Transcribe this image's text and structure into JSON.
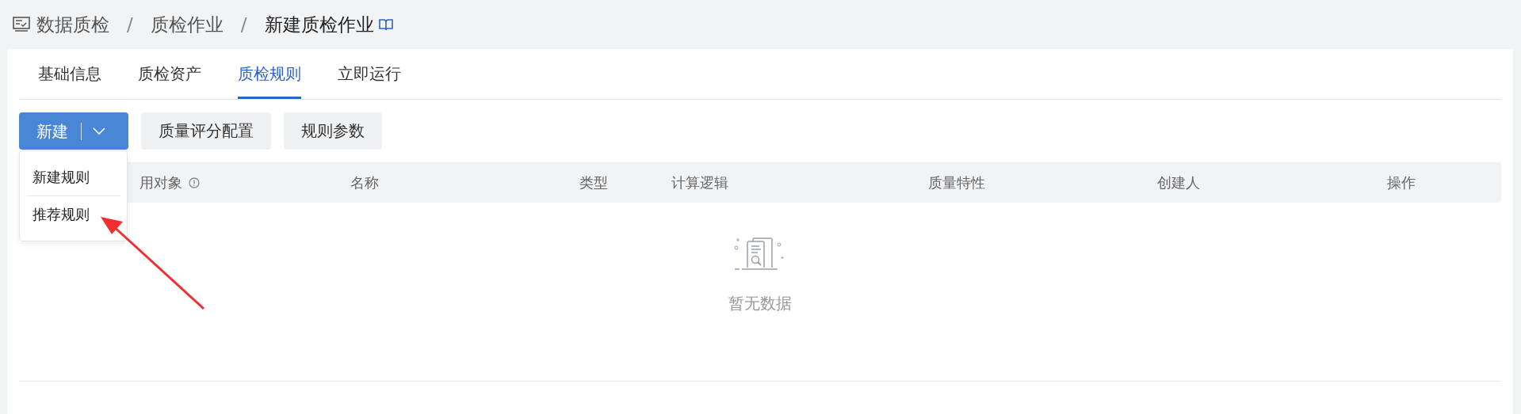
{
  "breadcrumb": [
    "数据质检",
    "质检作业",
    "新建质检作业"
  ],
  "separator": "/",
  "tabs": [
    {
      "label": "基础信息",
      "selected": false
    },
    {
      "label": "质检资产",
      "selected": false
    },
    {
      "label": "质检规则",
      "selected": true
    },
    {
      "label": "立即运行",
      "selected": false
    }
  ],
  "toolbar": {
    "new_button": "新建",
    "buttons": [
      "质量评分配置",
      "规则参数"
    ]
  },
  "dropdown": {
    "items": [
      "新建规则",
      "推荐规则"
    ]
  },
  "table": {
    "columns": [
      "用对象",
      "名称",
      "类型",
      "计算逻辑",
      "质量特性",
      "创建人",
      "操作"
    ],
    "empty_text": "暂无数据"
  }
}
